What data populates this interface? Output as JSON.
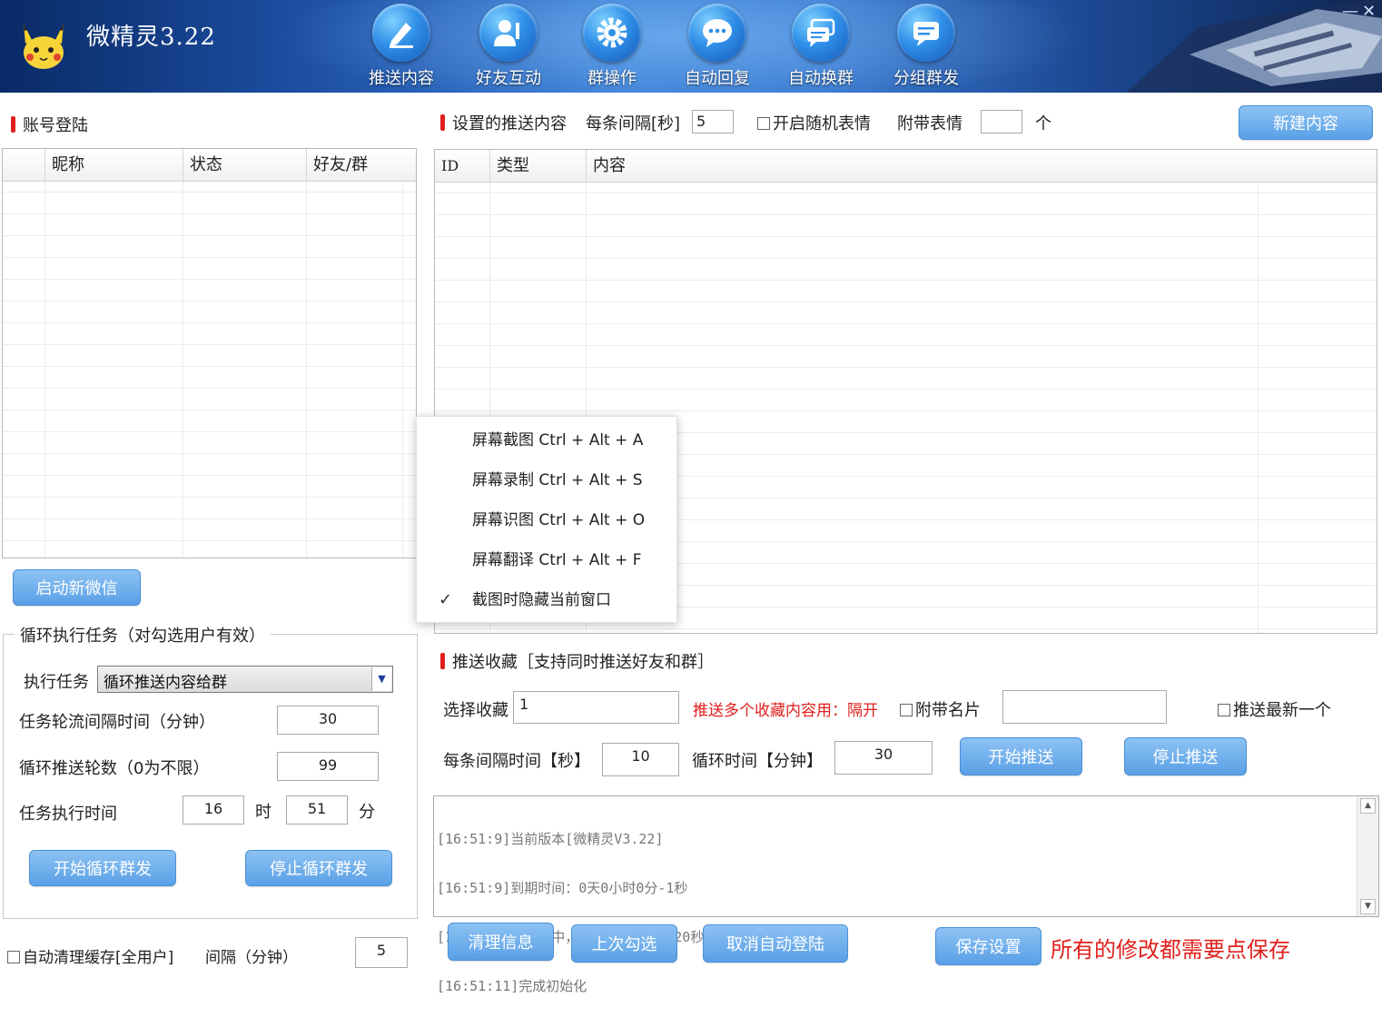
{
  "app": {
    "title": "微精灵3.22",
    "toolbar": [
      {
        "label": "推送内容",
        "icon": "pen-icon"
      },
      {
        "label": "好友互动",
        "icon": "user-icon"
      },
      {
        "label": "群操作",
        "icon": "gear-icon"
      },
      {
        "label": "自动回复",
        "icon": "chat-bubble-icon"
      },
      {
        "label": "自动换群",
        "icon": "chat-swap-icon"
      },
      {
        "label": "分组群发",
        "icon": "chat-group-icon"
      }
    ]
  },
  "account": {
    "title": "账号登陆",
    "columns": [
      "昵称",
      "状态",
      "好友/群"
    ],
    "launch_button": "启动新微信"
  },
  "loop": {
    "group_title": "循环执行任务（对勾选用户有效）",
    "task_label": "执行任务",
    "task_value": "循环推送内容给群",
    "interval_label": "任务轮流间隔时间（分钟）",
    "interval_value": "30",
    "rounds_label": "循环推送轮数（0为不限）",
    "rounds_value": "99",
    "time_label": "任务执行时间",
    "hour_value": "16",
    "hour_unit": "时",
    "minute_value": "51",
    "minute_unit": "分",
    "start_button": "开始循环群发",
    "stop_button": "停止循环群发"
  },
  "cache": {
    "auto_clear_label": "自动清理缓存[全用户]",
    "interval_label": "间隔（分钟）",
    "interval_value": "5"
  },
  "content": {
    "title": "设置的推送内容",
    "interval_label": "每条间隔[秒]",
    "interval_value": "5",
    "random_emoji_label": "开启随机表情",
    "attach_emoji_label": "附带表情",
    "attach_emoji_value": "",
    "unit": "个",
    "new_button": "新建内容",
    "columns": [
      "ID",
      "类型",
      "内容"
    ]
  },
  "context_menu": {
    "items": [
      {
        "label": "屏幕截图 Ctrl + Alt + A",
        "checked": false
      },
      {
        "label": "屏幕录制 Ctrl + Alt + S",
        "checked": false
      },
      {
        "label": "屏幕识图 Ctrl + Alt + O",
        "checked": false
      },
      {
        "label": "屏幕翻译 Ctrl + Alt + F",
        "checked": false
      },
      {
        "label": "截图时隐藏当前窗口",
        "checked": true
      }
    ]
  },
  "favorites": {
    "title": "推送收藏［支持同时推送好友和群］",
    "select_label": "选择收藏",
    "select_value": "1",
    "hint": "推送多个收藏内容用：隔开",
    "card_label": "附带名片",
    "card_value": "",
    "latest_label": "推送最新一个",
    "interval_label": "每条间隔时间【秒】",
    "interval_value": "10",
    "loop_label": "循环时间【分钟】",
    "loop_value": "30",
    "start_button": "开始推送",
    "stop_button": "停止推送"
  },
  "log": {
    "lines": [
      "[16:51:9]当前版本[微精灵V3.22]",
      "[16:51:9]到期时间：0天0小时0分-1秒",
      "[16:51:9]初始化中，此过程大约需要20秒，请耐心等待...",
      "[16:51:11]完成初始化"
    ]
  },
  "bottom": {
    "clear_button": "清理信息",
    "last_button": "上次勾选",
    "cancel_login_button": "取消自动登陆",
    "save_button": "保存设置",
    "save_hint": "所有的修改都需要点保存"
  }
}
